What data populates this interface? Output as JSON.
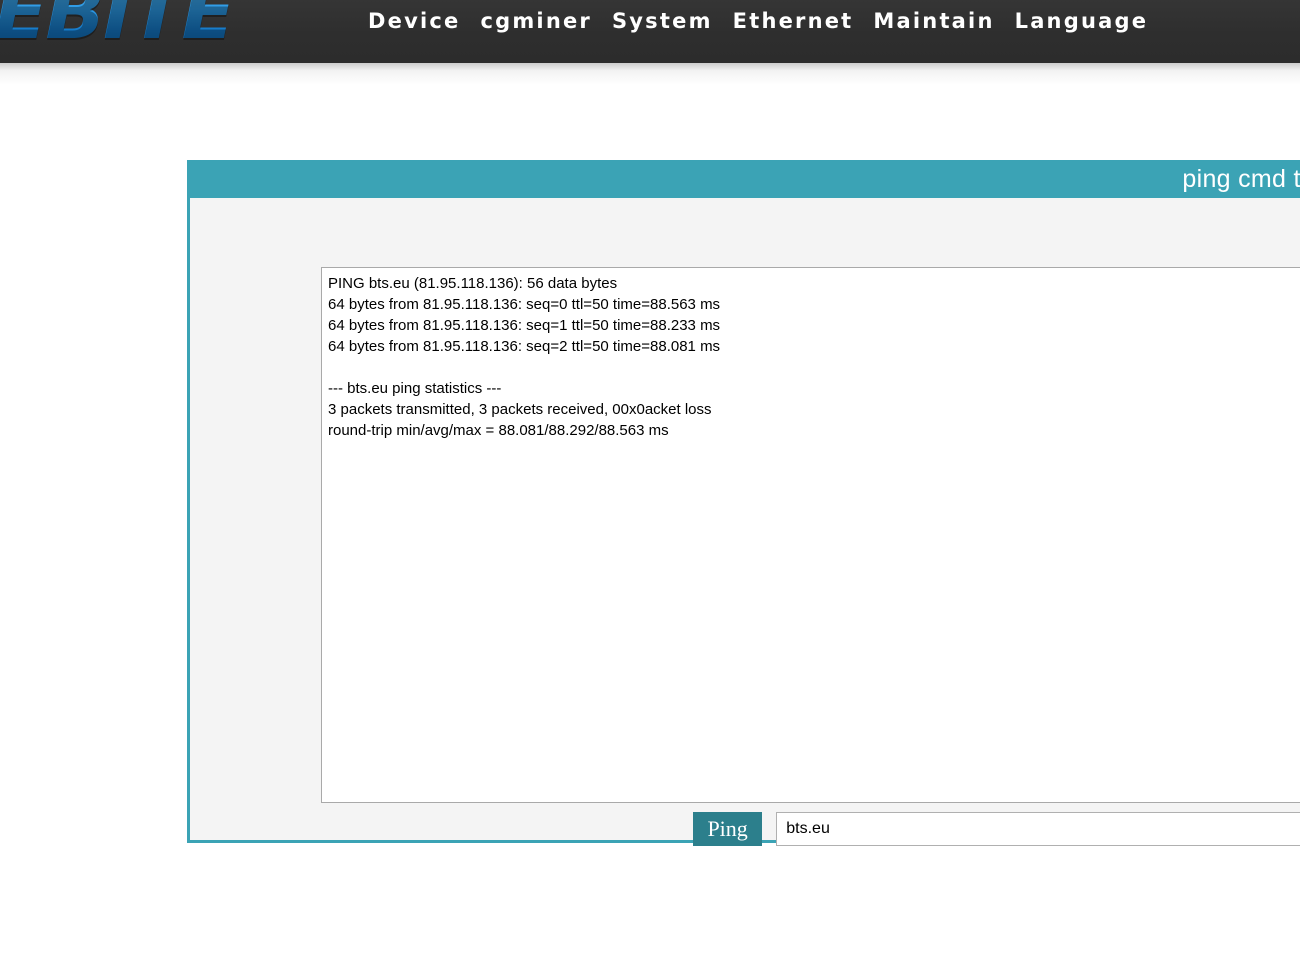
{
  "brand": {
    "logo_text": "EBITE",
    "logo_color": "#2d9ae6"
  },
  "nav": {
    "items": [
      {
        "label": "Device"
      },
      {
        "label": "cgminer"
      },
      {
        "label": "System"
      },
      {
        "label": "Ethernet"
      },
      {
        "label": "Maintain"
      },
      {
        "label": "Language"
      }
    ]
  },
  "panel": {
    "title": "ping cmd test",
    "header_color": "#3ba3b5",
    "body_color": "#f4f4f4"
  },
  "console": {
    "output": "PING bts.eu (81.95.118.136): 56 data bytes\n64 bytes from 81.95.118.136: seq=0 ttl=50 time=88.563 ms\n64 bytes from 81.95.118.136: seq=1 ttl=50 time=88.233 ms\n64 bytes from 81.95.118.136: seq=2 ttl=50 time=88.081 ms\n\n--- bts.eu ping statistics ---\n3 packets transmitted, 3 packets received, 00x0acket loss\nround-trip min/avg/max = 88.081/88.292/88.563 ms"
  },
  "command_bar": {
    "ping_button_label": "Ping",
    "ping_button_color": "#2c7f8c",
    "host_value": "bts.eu",
    "host_placeholder": ""
  }
}
